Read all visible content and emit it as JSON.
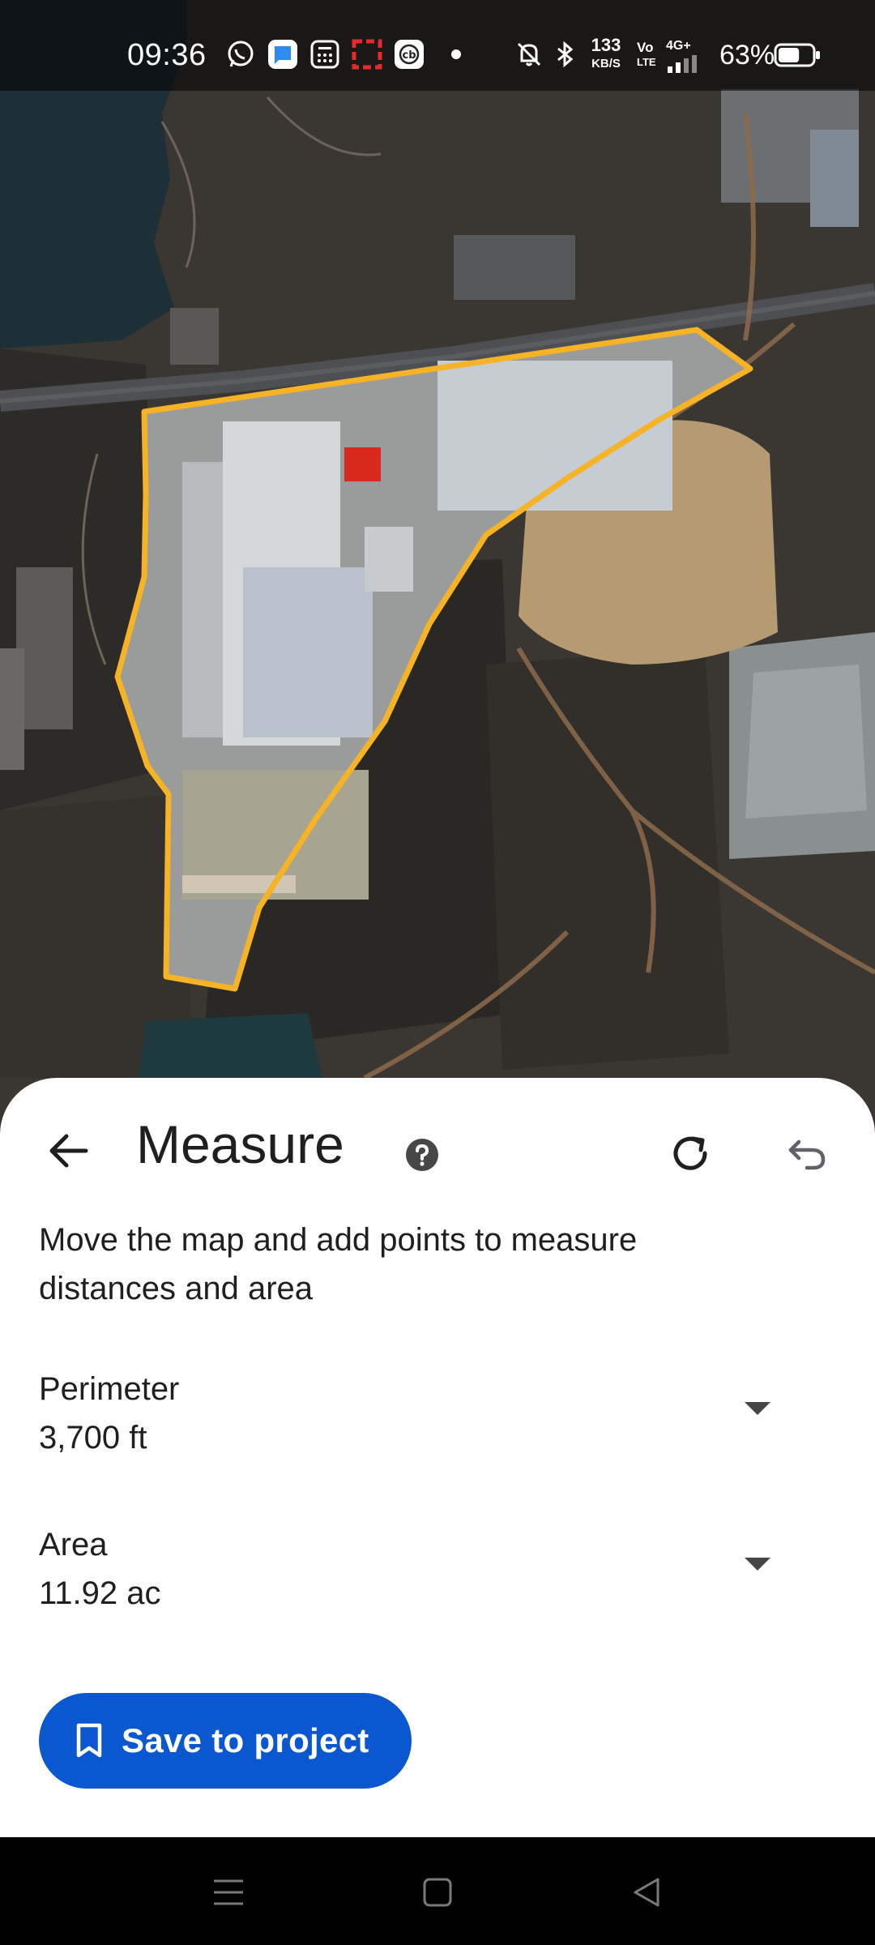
{
  "status_bar": {
    "time": "09:36",
    "net_speed_value": "133",
    "net_speed_unit": "KB/S",
    "volte_top": "Vo",
    "volte_bottom": "LTE",
    "signal": "4G+",
    "battery": "63%",
    "battery_level": 0.63,
    "icons": [
      "whatsapp-icon",
      "messages-app-icon",
      "calculator-icon",
      "screenshot-app-icon",
      "cb-app-icon",
      "notification-dot-icon",
      "mute-icon",
      "bluetooth-icon",
      "signal-icon",
      "battery-icon"
    ]
  },
  "map": {
    "type": "satellite",
    "outline_color": "#f5b325"
  },
  "sheet": {
    "title": "Measure",
    "instructions": "Move the map and add points to measure distances and area",
    "perimeter_label": "Perimeter",
    "perimeter_value": "3,700 ft",
    "area_label": "Area",
    "area_value": "11.92 ac",
    "save_label": "Save to project",
    "accent_color": "#0b57d0"
  },
  "nav_bar": {
    "buttons": [
      "menu-nav-icon",
      "home-nav-icon",
      "back-nav-icon"
    ]
  }
}
